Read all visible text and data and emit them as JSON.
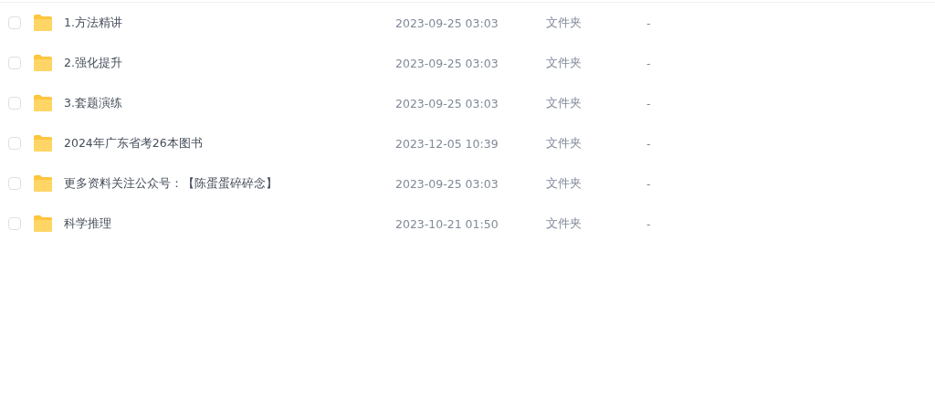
{
  "rows": [
    {
      "name": "1.方法精讲",
      "modified": "2023-09-25 03:03",
      "type": "文件夹",
      "size": "-",
      "checked": false
    },
    {
      "name": "2.强化提升",
      "modified": "2023-09-25 03:03",
      "type": "文件夹",
      "size": "-",
      "checked": false
    },
    {
      "name": "3.套题演练",
      "modified": "2023-09-25 03:03",
      "type": "文件夹",
      "size": "-",
      "checked": false
    },
    {
      "name": "2024年广东省考26本图书",
      "modified": "2023-12-05 10:39",
      "type": "文件夹",
      "size": "-",
      "checked": false
    },
    {
      "name": "更多资料关注公众号：【陈蛋蛋碎碎念】",
      "modified": "2023-09-25 03:03",
      "type": "文件夹",
      "size": "-",
      "checked": false
    },
    {
      "name": "科学推理",
      "modified": "2023-10-21 01:50",
      "type": "文件夹",
      "size": "-",
      "checked": false
    }
  ]
}
